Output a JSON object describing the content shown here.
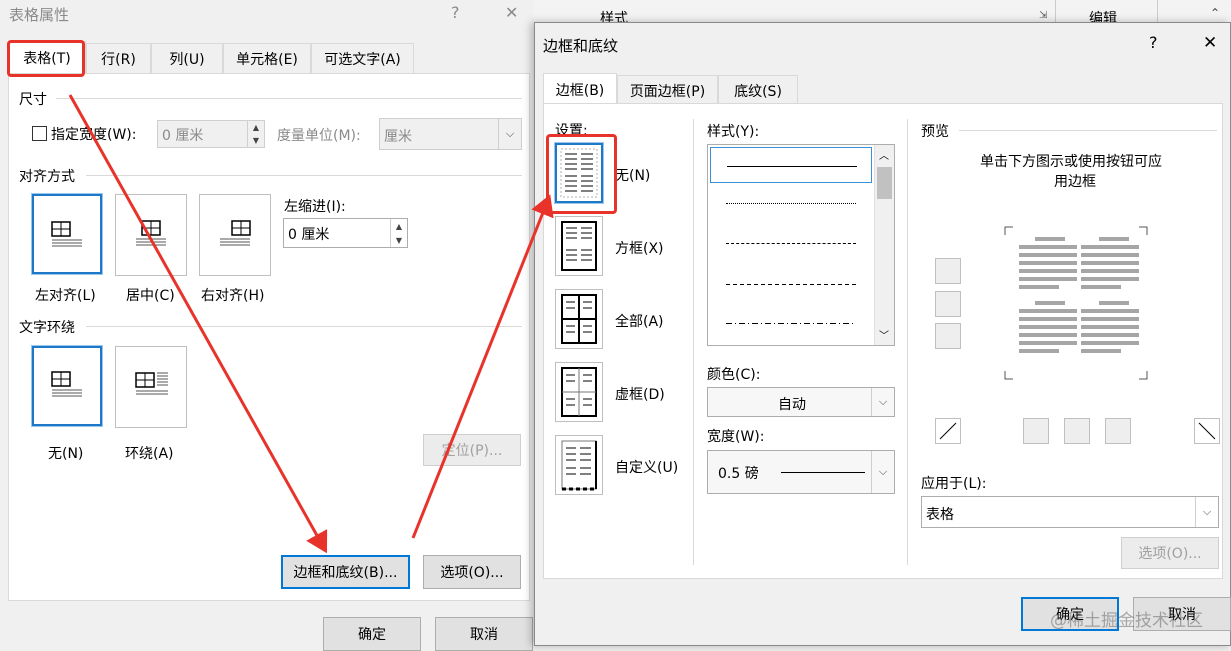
{
  "left_dialog": {
    "title": "表格属性",
    "help": "?",
    "close": "✕",
    "tabs": [
      "表格(T)",
      "行(R)",
      "列(U)",
      "单元格(E)",
      "可选文字(A)"
    ],
    "size_section": "尺寸",
    "specify_width": "指定宽度(W):",
    "width_value": "0 厘米",
    "measure_unit_label": "度量单位(M):",
    "measure_unit_value": "厘米",
    "alignment_section": "对齐方式",
    "align_left": "左对齐(L)",
    "align_center": "居中(C)",
    "align_right": "右对齐(H)",
    "indent_label": "左缩进(I):",
    "indent_value": "0 厘米",
    "wrap_section": "文字环绕",
    "wrap_none": "无(N)",
    "wrap_around": "环绕(A)",
    "position_button": "定位(P)...",
    "borders_button": "边框和底纹(B)...",
    "options_button": "选项(O)...",
    "ok_button": "确定",
    "cancel_button": "取消"
  },
  "background_ribbon": {
    "styles": "样式",
    "editing": "编辑"
  },
  "right_dialog": {
    "title": "边框和底纹",
    "help": "?",
    "close": "✕",
    "tabs": [
      "边框(B)",
      "页面边框(P)",
      "底纹(S)"
    ],
    "settings_label": "设置:",
    "setting_none": "无(N)",
    "setting_box": "方框(X)",
    "setting_all": "全部(A)",
    "setting_grid": "虚框(D)",
    "setting_custom": "自定义(U)",
    "style_label": "样式(Y):",
    "color_label": "颜色(C):",
    "color_value": "自动",
    "width_label": "宽度(W):",
    "width_value": "0.5 磅",
    "preview_label": "预览",
    "preview_hint_1": "单击下方图示或使用按钮可应",
    "preview_hint_2": "用边框",
    "apply_to_label": "应用于(L):",
    "apply_to_value": "表格",
    "options_button": "选项(O)...",
    "ok_button": "确定",
    "cancel_button": "取消"
  },
  "watermark": "@稀土掘金技术社区",
  "annotation_color": "#e8332a",
  "accent_color": "#1e78c8"
}
